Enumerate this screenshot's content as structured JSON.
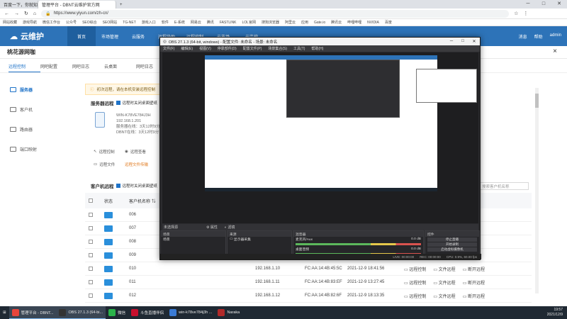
{
  "browser": {
    "tabs": [
      "百度一下，你就知道",
      "管理平台 - DBNT云维护官方网",
      "+"
    ],
    "url": "https://www.yiyun.com/zh-cn/",
    "secure_label": "安全",
    "bookmarks": [
      "网站收藏",
      "游戏导航",
      "微信工作台",
      "公众号",
      "SEO综合",
      "SEO网站",
      "TG-NET",
      "游戏入口",
      "软件",
      "E-系统",
      "网易云",
      "腾讯",
      "FASTLINK",
      "LOL官网",
      "搜狗浏览器",
      "阿里云",
      "应用",
      "Gate.io",
      "腾讯云",
      "哔哩哔哩",
      "NVIDIA",
      "百度"
    ]
  },
  "app": {
    "logo_text": "云维护",
    "nav": [
      "首页",
      "市场管理",
      "云服务",
      "远程协助",
      "远程控制",
      "云市场",
      "云监控"
    ],
    "nav_active": 0,
    "user_items": [
      "消息",
      "帮助",
      "admin"
    ],
    "page_title": "桃花源网咖",
    "close_label": "×",
    "subtabs": [
      "远程控制",
      "网吧配置",
      "网吧日志",
      "云桌面",
      "网吧日志"
    ],
    "sidebar": [
      "服务器",
      "客户机",
      "路由器",
      "端口映射"
    ],
    "notice": "初次远程，请在本机安装远程控制",
    "server_section": "服务器远程",
    "server_checkbox": "远程时关闭桌面壁纸",
    "server": {
      "name": "WIN-K78VE784J3H",
      "ip": "192.168.1.201",
      "status": "服务器在线：3天12时9分",
      "dbnt": "DBNT在线：3天12时9分"
    },
    "server_buttons": [
      "远程控制",
      "远程查看",
      "远程文件",
      "远程文件传输"
    ],
    "client_section": "客户机远程",
    "client_checkbox": "远程时关闭桌面壁纸",
    "search_placeholder": "搜索客户机名称",
    "table_headers": [
      "状态",
      "客户机名称",
      "",
      "",
      "",
      ""
    ],
    "rows": [
      {
        "name": "006",
        "ip": "",
        "mac": "",
        "time": "",
        "actions": []
      },
      {
        "name": "007",
        "ip": "",
        "mac": "",
        "time": "",
        "actions": []
      },
      {
        "name": "008",
        "ip": "",
        "mac": "",
        "time": "",
        "actions": []
      },
      {
        "name": "009",
        "ip": "",
        "mac": "",
        "time": "",
        "actions": []
      },
      {
        "name": "010",
        "ip": "192.168.1.10",
        "mac": "FC:AA:14:4B:45:5C",
        "time": "2021-12-9 18:41:56",
        "actions": [
          "远程控制",
          "文件远程",
          "断开远程"
        ]
      },
      {
        "name": "011",
        "ip": "192.168.1.11",
        "mac": "FC:AA:14:4B:83:EF",
        "time": "2021-12-9 13:27:45",
        "actions": [
          "远程控制",
          "文件远程",
          "断开远程"
        ]
      },
      {
        "name": "012",
        "ip": "192.168.1.12",
        "mac": "FC:AA:14:4B:82:6F",
        "time": "2021-12-9 18:13:35",
        "actions": [
          "远程控制",
          "文件远程",
          "断开远程"
        ]
      }
    ]
  },
  "obs": {
    "title": "OBS 27.1.3 (64-bit, windows) - 配置文件: 未命名 - 场景: 未命名",
    "menu": [
      "文件(F)",
      "编辑(E)",
      "视图(V)",
      "停靠部件(D)",
      "配置文件(P)",
      "场景集合(S)",
      "工具(T)",
      "帮助(H)"
    ],
    "dock_title": "未选择源",
    "dock_buttons": [
      "属性",
      "滤镜"
    ],
    "panels": {
      "scenes": {
        "title": "场景",
        "items": [
          "场景"
        ]
      },
      "sources": {
        "title": "来源",
        "items": [
          "显示器采集"
        ]
      },
      "mixer": {
        "title": "混音器",
        "items": [
          "麦克风/Aux",
          "桌面音频"
        ],
        "db": [
          "0.0 dB",
          "0.0 dB"
        ]
      },
      "controls": {
        "title": "控件",
        "items": [
          "停止直播",
          "开始录制",
          "启动虚拟摄像机",
          "工作室模式",
          "设置",
          "退出"
        ]
      }
    },
    "bottom_tabs": [
      "控件",
      "转场特效"
    ],
    "status": [
      "LIVE: 00:00:00",
      "REC: 00:00:00",
      "CPU: 0.9%, 60.00 fps"
    ]
  },
  "taskbar": {
    "items": [
      "管理平台 - DBNT...",
      "OBS 27.1.3 (64-bi...",
      "微信",
      "斗鱼直播伴侣",
      "win-k78ve784j3h ...",
      "Naraka"
    ],
    "time": "19:57",
    "date": "2021/12/9"
  }
}
